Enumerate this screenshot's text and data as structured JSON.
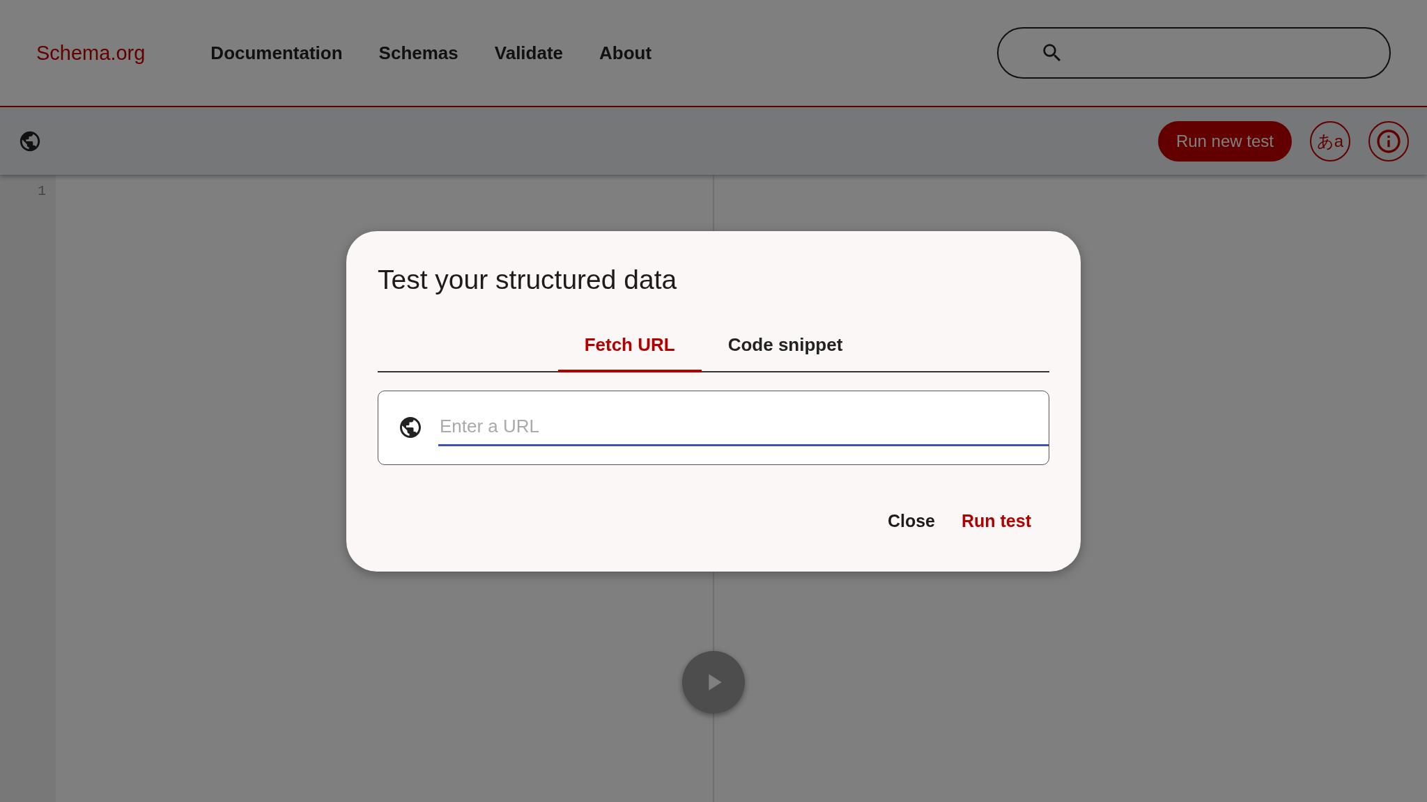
{
  "header": {
    "brand": "Schema.org",
    "nav": [
      "Documentation",
      "Schemas",
      "Validate",
      "About"
    ]
  },
  "toolbar": {
    "run_new_test": "Run new test",
    "language_button": "あa"
  },
  "editor": {
    "line_numbers": [
      "1"
    ]
  },
  "dialog": {
    "title": "Test your structured data",
    "tabs": [
      {
        "label": "Fetch URL",
        "selected": true
      },
      {
        "label": "Code snippet",
        "selected": false
      }
    ],
    "url_field": {
      "placeholder": "Enter a URL"
    },
    "actions": [
      {
        "label": "Close",
        "kind": "plain"
      },
      {
        "label": "Run test",
        "kind": "primary"
      }
    ]
  }
}
